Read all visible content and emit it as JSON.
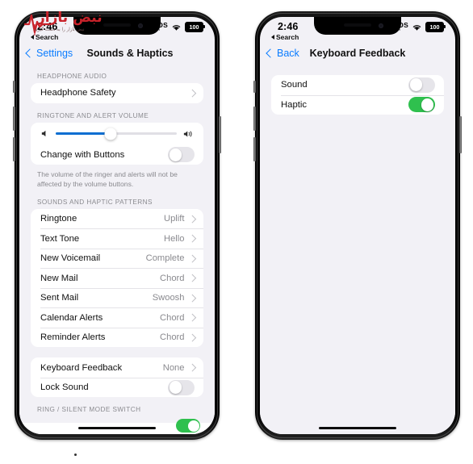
{
  "status_bar": {
    "time": "2:46",
    "sos_label": "SOS",
    "sos_dots": "••••",
    "battery_level": "100",
    "wifi_icon": "wifi-icon",
    "battery_icon": "battery-icon"
  },
  "back_chip": {
    "label": "Search",
    "icon": "back-triangle-icon"
  },
  "watermark": {
    "title": "نبض بازار",
    "subtitle": "نبض بازار را به دست گیرید",
    "accent_color": "#c8222a",
    "icon": "heartbeat-pulse-icon"
  },
  "left_phone": {
    "nav": {
      "back_label": "Settings",
      "title": "Sounds & Haptics"
    },
    "sections": [
      {
        "header": "HEADPHONE AUDIO",
        "rows": [
          {
            "label": "Headphone Safety",
            "value": "",
            "type": "disclosure"
          }
        ]
      },
      {
        "header": "RINGTONE AND ALERT VOLUME",
        "slider": {
          "value_percent": 45,
          "min_icon": "speaker-low-icon",
          "max_icon": "speaker-high-icon"
        },
        "rows": [
          {
            "label": "Change with Buttons",
            "value": "",
            "type": "toggle",
            "on": false
          }
        ],
        "footnote": "The volume of the ringer and alerts will not be affected by the volume buttons."
      },
      {
        "header": "SOUNDS AND HAPTIC PATTERNS",
        "rows": [
          {
            "label": "Ringtone",
            "value": "Uplift",
            "type": "disclosure"
          },
          {
            "label": "Text Tone",
            "value": "Hello",
            "type": "disclosure"
          },
          {
            "label": "New Voicemail",
            "value": "Complete",
            "type": "disclosure"
          },
          {
            "label": "New Mail",
            "value": "Chord",
            "type": "disclosure"
          },
          {
            "label": "Sent Mail",
            "value": "Swoosh",
            "type": "disclosure"
          },
          {
            "label": "Calendar Alerts",
            "value": "Chord",
            "type": "disclosure"
          },
          {
            "label": "Reminder Alerts",
            "value": "Chord",
            "type": "disclosure"
          }
        ]
      },
      {
        "header": "",
        "rows": [
          {
            "label": "Keyboard Feedback",
            "value": "None",
            "type": "disclosure"
          },
          {
            "label": "Lock Sound",
            "value": "",
            "type": "toggle",
            "on": false
          }
        ]
      },
      {
        "header": "RING / SILENT MODE SWITCH",
        "rows": []
      }
    ]
  },
  "right_phone": {
    "nav": {
      "back_label": "Back",
      "title": "Keyboard Feedback"
    },
    "sections": [
      {
        "header": "",
        "rows": [
          {
            "label": "Sound",
            "value": "",
            "type": "toggle",
            "on": false
          },
          {
            "label": "Haptic",
            "value": "",
            "type": "toggle",
            "on": true
          }
        ]
      }
    ]
  },
  "colors": {
    "accent_blue": "#0a7cff",
    "toggle_green": "#2fc04e",
    "slider_blue": "#0a6ed1",
    "screen_bg": "#f2f1f6",
    "card_bg": "#ffffff",
    "secondary_text": "#8a8a8f"
  }
}
